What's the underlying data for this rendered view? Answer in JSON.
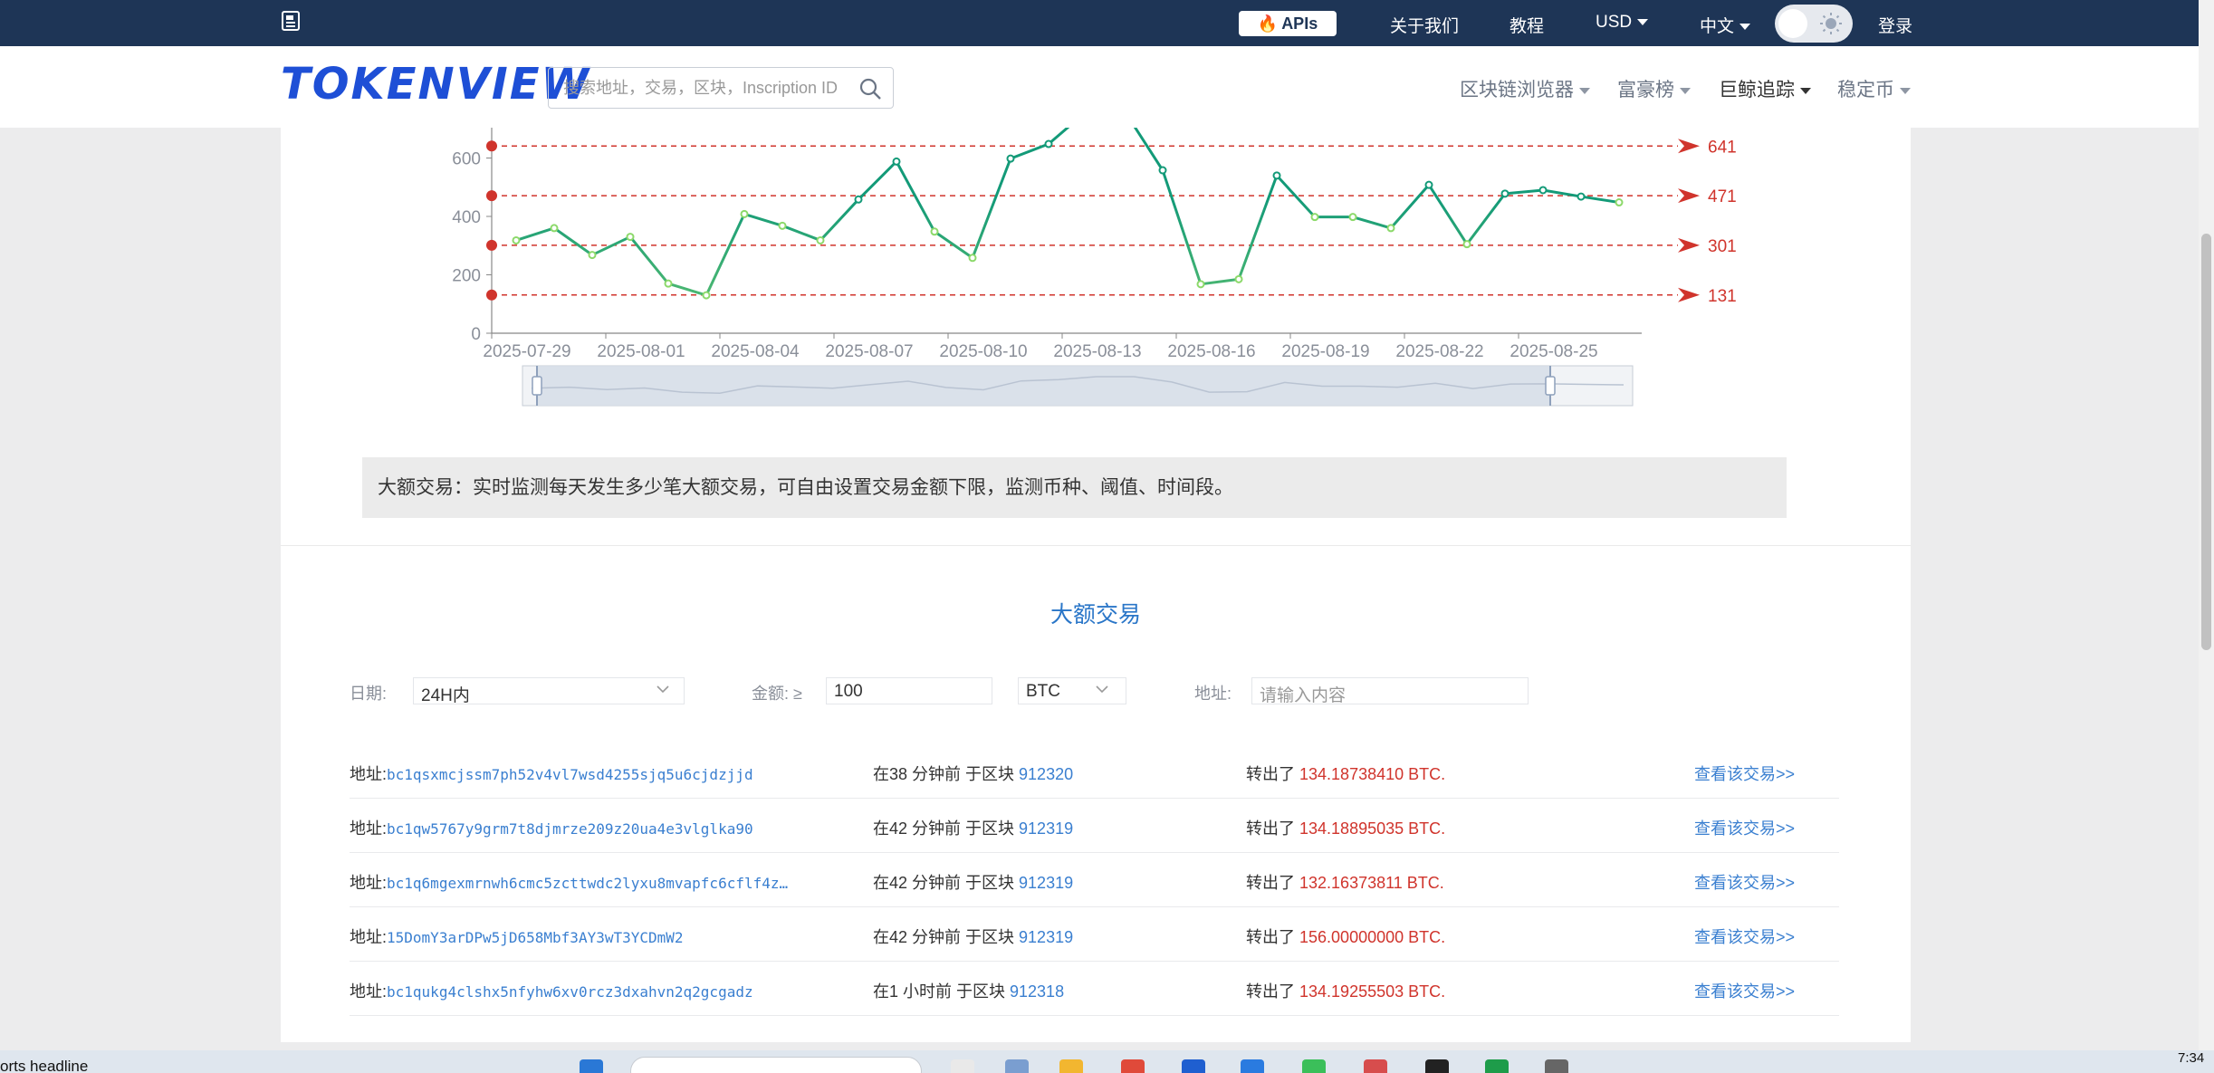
{
  "topbar": {
    "apis_label": "APIs",
    "about_label": "关于我们",
    "tutorial_label": "教程",
    "currency_label": "USD",
    "language_label": "中文",
    "login_label": "登录"
  },
  "header": {
    "logo_text": "TOKENVIEW",
    "search_placeholder": "搜索地址，交易，区块，Inscription ID",
    "nav": [
      {
        "label": "区块链浏览器"
      },
      {
        "label": "富豪榜"
      },
      {
        "label": "巨鲸追踪"
      },
      {
        "label": "稳定币"
      }
    ]
  },
  "chart_data": {
    "type": "line",
    "x": [
      "2025-07-29",
      "2025-07-30",
      "2025-07-31",
      "2025-08-01",
      "2025-08-02",
      "2025-08-03",
      "2025-08-04",
      "2025-08-05",
      "2025-08-06",
      "2025-08-07",
      "2025-08-08",
      "2025-08-09",
      "2025-08-10",
      "2025-08-11",
      "2025-08-12",
      "2025-08-13",
      "2025-08-14",
      "2025-08-15",
      "2025-08-16",
      "2025-08-17",
      "2025-08-18",
      "2025-08-19",
      "2025-08-20",
      "2025-08-21",
      "2025-08-22",
      "2025-08-23",
      "2025-08-24",
      "2025-08-25",
      "2025-08-26",
      "2025-08-27"
    ],
    "x_tick_labels": [
      "2025-07-29",
      "2025-08-01",
      "2025-08-04",
      "2025-08-07",
      "2025-08-10",
      "2025-08-13",
      "2025-08-16",
      "2025-08-19",
      "2025-08-22",
      "2025-08-25"
    ],
    "values": [
      318,
      360,
      268,
      330,
      170,
      130,
      408,
      368,
      318,
      458,
      588,
      348,
      258,
      598,
      648,
      760,
      760,
      558,
      168,
      185,
      540,
      398,
      398,
      360,
      508,
      305,
      478,
      490,
      468,
      448
    ],
    "y_ticks": [
      0,
      200,
      400,
      600
    ],
    "ylim": [
      0,
      700
    ],
    "grid": false,
    "reference_lines": [
      {
        "value": 641,
        "label": "641"
      },
      {
        "value": 471,
        "label": "471"
      },
      {
        "value": 301,
        "label": "301"
      },
      {
        "value": 131,
        "label": "131"
      }
    ],
    "colors": {
      "line_light": "#8cd96a",
      "line_dark": "#139a78",
      "reference": "#d0342c",
      "axis": "#888888"
    }
  },
  "notice_text": "大额交易：实时监测每天发生多少笔大额交易，可自由设置交易金额下限，监测币种、阈值、时间段。",
  "section_title": "大额交易",
  "filters": {
    "date_label": "日期:",
    "date_value": "24H内",
    "amount_label": "金额: ≥",
    "amount_value": "100",
    "coin_value": "BTC",
    "address_label": "地址:",
    "address_placeholder": "请输入内容"
  },
  "transactions": [
    {
      "addr_label": "地址:",
      "address": "bc1qsxmcjssm7ph52v4vl7wsd4255sjq5u6cjdzjjd",
      "time": "在38 分钟前 于区块 ",
      "block": "912320",
      "out_label": "转出了 ",
      "amount": "134.18738410 BTC.",
      "link": "查看该交易>>"
    },
    {
      "addr_label": "地址:",
      "address": "bc1qw5767y9grm7t8djmrze209z20ua4e3vlglka90",
      "time": "在42 分钟前 于区块 ",
      "block": "912319",
      "out_label": "转出了 ",
      "amount": "134.18895035 BTC.",
      "link": "查看该交易>>"
    },
    {
      "addr_label": "地址:",
      "address": "bc1q6mgexmrnwh6cmc5zcttwdc2lyxu8mvapfc6cflf4z…",
      "time": "在42 分钟前 于区块 ",
      "block": "912319",
      "out_label": "转出了 ",
      "amount": "132.16373811 BTC.",
      "link": "查看该交易>>"
    },
    {
      "addr_label": "地址:",
      "address": "15DomY3arDPw5jD658Mbf3AY3wT3YCDmW2",
      "time": "在42 分钟前 于区块 ",
      "block": "912319",
      "out_label": "转出了 ",
      "amount": "156.00000000 BTC.",
      "link": "查看该交易>>"
    },
    {
      "addr_label": "地址:",
      "address": "bc1qukg4clshx5nfyhw6xv0rcz3dxahvn2q2gcgadz",
      "time": "在1 小时前 于区块 ",
      "block": "912318",
      "out_label": "转出了 ",
      "amount": "134.19255503 BTC.",
      "link": "查看该交易>>"
    }
  ],
  "taskbar": {
    "news_text": "orts headline",
    "clock": "7:34"
  }
}
